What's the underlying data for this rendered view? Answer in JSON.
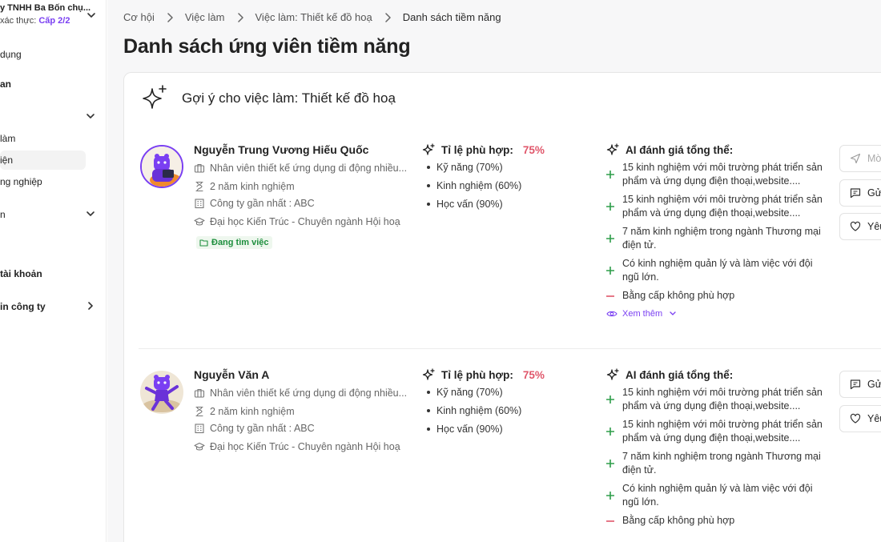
{
  "sidebar": {
    "company_name": "y TNHH Ba Bốn chụ...",
    "verify_prefix": "xác thực:",
    "verify_level": "Cấp 2/2",
    "items": [
      {
        "label": "dụng"
      },
      {
        "label": "an"
      },
      {
        "label": "làm"
      },
      {
        "label": "iện"
      },
      {
        "label": "ng nghiệp"
      },
      {
        "label": "n"
      },
      {
        "label": "tài khoản"
      },
      {
        "label": "in công ty"
      }
    ]
  },
  "breadcrumb": [
    "Cơ hội",
    "Việc làm",
    "Việc làm: Thiết kế đồ hoạ",
    "Danh sách tiềm năng"
  ],
  "page_title": "Danh sách ứng viên tiềm năng",
  "card": {
    "title": "Gợi ý cho việc làm: Thiết kế đồ hoạ"
  },
  "candidates": [
    {
      "name": "Nguyễn Trung Vương Hiếu Quốc",
      "position": "Nhân viên thiết kế ứng dụng di động nhiều...",
      "experience": "2 năm kinh nghiệm",
      "company": "Công ty gần nhất : ABC",
      "education": "Đại học Kiến Trúc - Chuyên ngành Hội hoạ",
      "status": "Đang tìm việc",
      "fit_label": "Tỉ lệ phù hợp:",
      "fit_pct": "75%",
      "fit_items": [
        "Kỹ năng (70%)",
        "Kinh nghiệm (60%)",
        "Học vấn (90%)"
      ],
      "ai_label": "AI đánh giá tổng thể:",
      "ai_items": [
        {
          "type": "plus",
          "text": "15 kinh nghiệm với môi trường phát triển sản phẩm và ứng dụng điện thoại,website...."
        },
        {
          "type": "plus",
          "text": "15 kinh nghiệm với môi trường phát triển sản phẩm và ứng dụng điện thoại,website...."
        },
        {
          "type": "plus",
          "text": "7 năm kinh nghiệm trong ngành Thương mại điện tử."
        },
        {
          "type": "plus",
          "text": "Có kinh nghiệm quản lý và làm việc với đội ngũ lớn."
        },
        {
          "type": "minus",
          "text": "Bằng cấp không phù hợp"
        }
      ],
      "see_more": "Xem thêm",
      "actions": [
        "Mờ",
        "Gửi",
        "Yêu"
      ]
    },
    {
      "name": "Nguyễn Văn A",
      "position": "Nhân viên thiết kế ứng dụng di động nhiều...",
      "experience": "2 năm kinh nghiệm",
      "company": "Công ty gần nhất : ABC",
      "education": "Đại học Kiến Trúc - Chuyên ngành Hội hoạ",
      "fit_label": "Tỉ lệ phù hợp:",
      "fit_pct": "75%",
      "fit_items": [
        "Kỹ năng (70%)",
        "Kinh nghiệm (60%)",
        "Học vấn (90%)"
      ],
      "ai_label": "AI đánh giá tổng thể:",
      "ai_items": [
        {
          "type": "plus",
          "text": "15 kinh nghiệm với môi trường phát triển sản phẩm và ứng dụng điện thoại,website...."
        },
        {
          "type": "plus",
          "text": "15 kinh nghiệm với môi trường phát triển sản phẩm và ứng dụng điện thoại,website...."
        },
        {
          "type": "plus",
          "text": "7 năm kinh nghiệm trong ngành Thương mại điện tử."
        },
        {
          "type": "plus",
          "text": "Có kinh nghiệm quản lý và làm việc với đội ngũ lớn."
        },
        {
          "type": "minus",
          "text": "Bằng cấp không phù hợp"
        }
      ],
      "actions": [
        "Gửi",
        "Yêu"
      ]
    }
  ],
  "colors": {
    "accent": "#7a3ff2",
    "fit_pct": "#e0576b",
    "plus": "#2e9d4a",
    "minus": "#e0576b",
    "status": "#1e8f3e"
  }
}
